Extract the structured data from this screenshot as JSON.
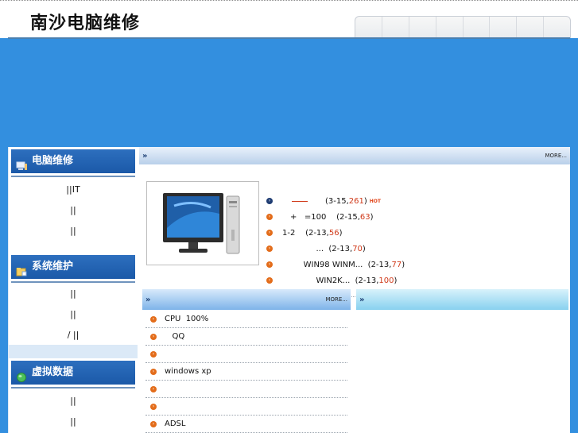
{
  "header": {
    "site_title": "南沙电脑维修"
  },
  "sidebar": {
    "sections": [
      {
        "title": "电脑维修",
        "links": [
          "||IT",
          "||",
          "||"
        ]
      },
      {
        "title": "系统维护",
        "links": [
          "||",
          "||",
          "/  ||"
        ]
      },
      {
        "title": "虚拟数据",
        "links": [
          "||",
          "||"
        ]
      }
    ]
  },
  "top_panel": {
    "arrow": "»",
    "more": "MORE...",
    "items": [
      {
        "prefix": "",
        "suffix": "(3-15,",
        "count": "261",
        "end": ")",
        "hot": "HOT"
      },
      {
        "prefix": "+   =100    ",
        "suffix": "(2-15,",
        "count": "63",
        "end": ")"
      },
      {
        "prefix": "1-2    ",
        "suffix": "(2-13,",
        "count": "56",
        "end": ")"
      },
      {
        "prefix": "              ...  ",
        "suffix": "(2-13,",
        "count": "70",
        "end": ")"
      },
      {
        "prefix": "         WIN98 WINM...  ",
        "suffix": "(2-13,",
        "count": "77",
        "end": ")"
      },
      {
        "prefix": "              WIN2K...  ",
        "suffix": "(2-13,",
        "count": "100",
        "end": ")"
      }
    ]
  },
  "lower_left": {
    "arrow": "»",
    "more": "MORE...",
    "items": [
      "CPU  100%",
      "   QQ",
      "",
      "windows xp",
      "",
      "",
      "ADSL"
    ]
  },
  "lower_right": {
    "arrow": "»"
  }
}
